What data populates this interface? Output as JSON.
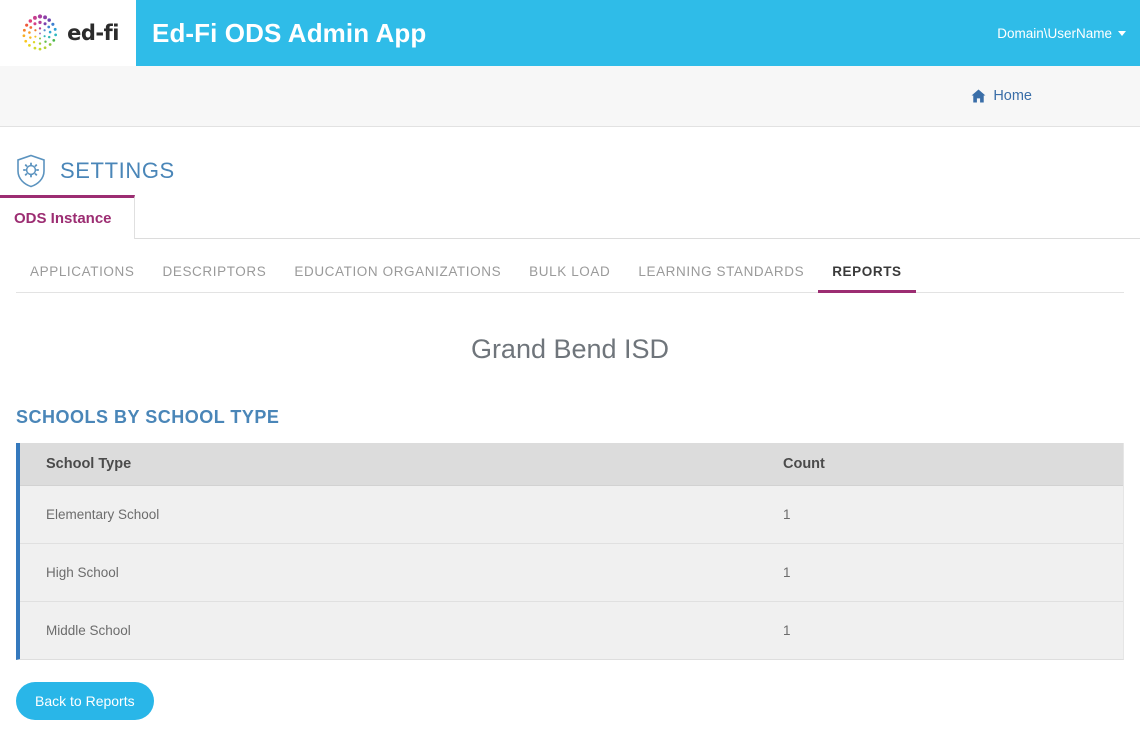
{
  "header": {
    "logo_icon": "ed-fi-logo-icon",
    "logo_word": "ed-fi",
    "app_title": "Ed-Fi ODS Admin App",
    "user_label": "Domain\\UserName",
    "caret_icon": "chevron-down-icon",
    "background_color": "#2fbce8"
  },
  "breadcrumb": {
    "home_icon": "home-icon",
    "home_label": "Home"
  },
  "page_head": {
    "icon": "shield-gear-icon",
    "title": "SETTINGS",
    "title_color": "#4a86b8"
  },
  "primary_tabs": [
    {
      "label": "ODS Instance",
      "active": true
    }
  ],
  "secondary_tabs": [
    {
      "label": "APPLICATIONS",
      "active": false
    },
    {
      "label": "DESCRIPTORS",
      "active": false
    },
    {
      "label": "EDUCATION ORGANIZATIONS",
      "active": false
    },
    {
      "label": "BULK LOAD",
      "active": false
    },
    {
      "label": "LEARNING STANDARDS",
      "active": false
    },
    {
      "label": "REPORTS",
      "active": true
    }
  ],
  "report": {
    "title": "Grand Bend ISD",
    "section_title": "SCHOOLS BY SCHOOL TYPE",
    "columns": [
      "School Type",
      "Count"
    ],
    "rows": [
      {
        "school_type": "Elementary School",
        "count": "1"
      },
      {
        "school_type": "High School",
        "count": "1"
      },
      {
        "school_type": "Middle School",
        "count": "1"
      }
    ],
    "accent_border_color": "#3579bd"
  },
  "actions": {
    "back_label": "Back to Reports",
    "back_color": "#29b6e8"
  }
}
